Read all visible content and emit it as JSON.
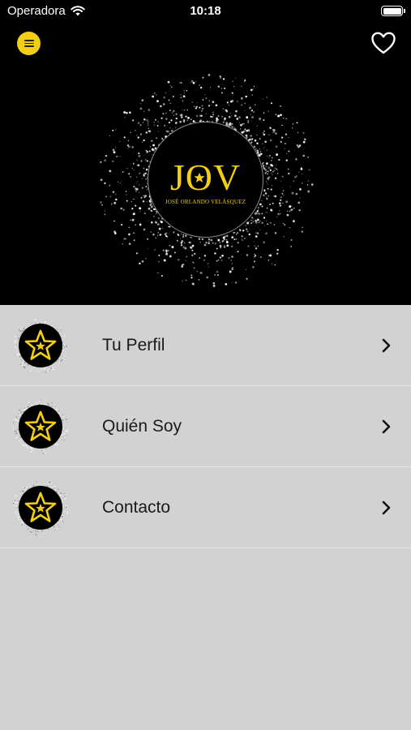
{
  "status_bar": {
    "carrier": "Operadora",
    "time": "10:18"
  },
  "header": {
    "menu_icon": "hamburger-icon",
    "favorite_icon": "heart-icon"
  },
  "logo": {
    "monogram_left": "J",
    "monogram_middle": "O",
    "monogram_right": "V",
    "subtitle": "JOSÉ ORLANDO VELÁSQUEZ"
  },
  "menu": {
    "items": [
      {
        "label": "Tu Perfil",
        "icon": "star-badge-icon"
      },
      {
        "label": "Quién Soy",
        "icon": "star-badge-icon"
      },
      {
        "label": "Contacto",
        "icon": "star-badge-icon"
      }
    ]
  },
  "colors": {
    "accent": "#f3cf14",
    "header_bg": "#000000",
    "list_bg": "#d2d2d2",
    "divider": "#e6e6e6"
  }
}
